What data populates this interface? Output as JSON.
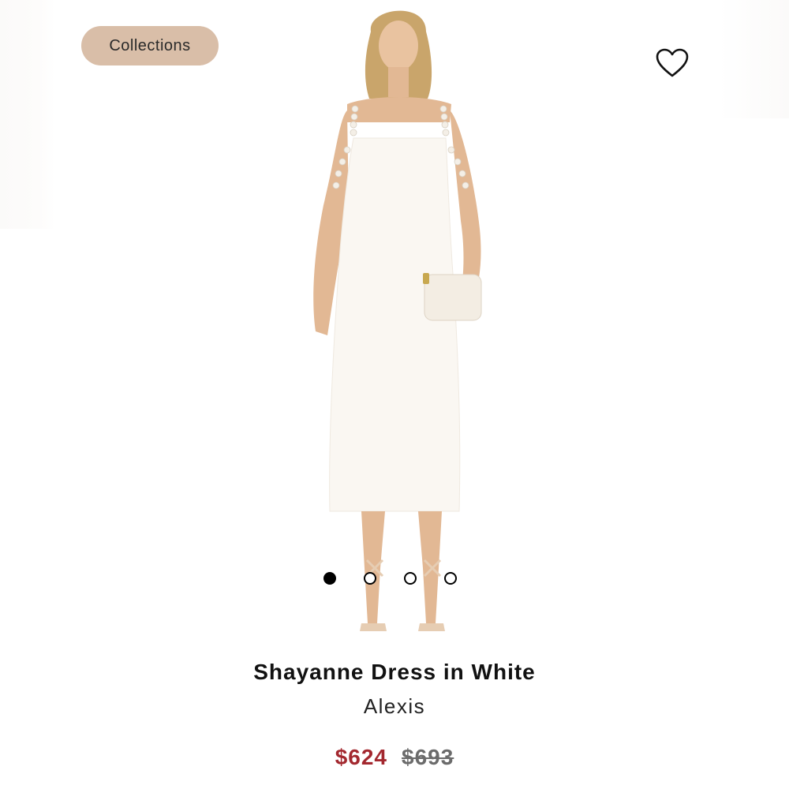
{
  "header": {
    "collections_label": "Collections",
    "favorite_icon": "heart-outline-icon"
  },
  "gallery": {
    "image_alt": "Model wearing white midi dress with pearl straps",
    "slide_count": 4,
    "active_slide": 1
  },
  "product": {
    "title": "Shayanne Dress in White",
    "brand": "Alexis",
    "sale_price": "$624",
    "original_price": "$693"
  },
  "colors": {
    "chip_background": "#d9bea8",
    "sale_price": "#a3282f",
    "dress": "#faf7f2"
  }
}
